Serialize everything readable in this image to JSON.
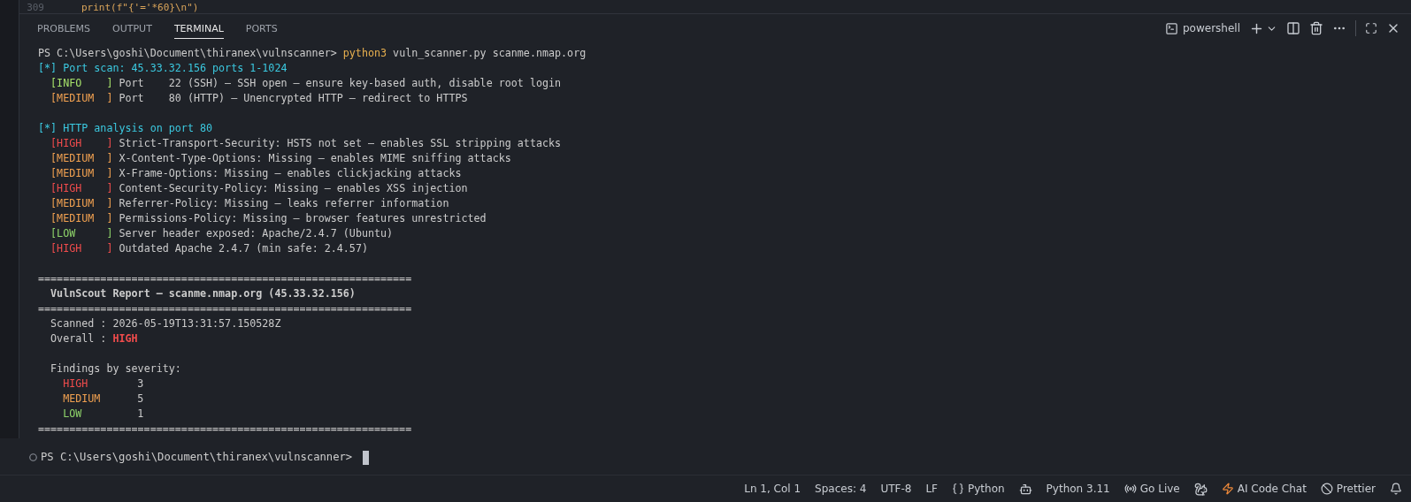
{
  "editor": {
    "line_number": "309",
    "code": "print(f\"{'='*60}\\n\")"
  },
  "panel_tabs": [
    {
      "label": "PROBLEMS",
      "selected": false
    },
    {
      "label": "OUTPUT",
      "selected": false
    },
    {
      "label": "TERMINAL",
      "selected": true
    },
    {
      "label": "PORTS",
      "selected": false
    }
  ],
  "terminal_toolbar": {
    "shell": "powershell"
  },
  "terminal": {
    "lines": [
      {
        "kind": "command",
        "prompt": "PS C:\\Users\\goshi\\Document\\thiranex\\vulnscanner>",
        "program": "python3",
        "args": "vuln_scanner.py scanme.nmap.org"
      },
      {
        "kind": "section",
        "text": "[*] Port scan: 45.33.32.156 ports 1-1024"
      },
      {
        "kind": "finding",
        "tag": "[INFO    ]",
        "color": "#a6e06a",
        "text": "Port    22 (SSH) — SSH open — ensure key-based auth, disable root login"
      },
      {
        "kind": "finding",
        "tag": "[MEDIUM  ]",
        "color": "#f0a050",
        "text": "Port    80 (HTTP) — Unencrypted HTTP — redirect to HTTPS"
      },
      {
        "kind": "blank"
      },
      {
        "kind": "section",
        "text": "[*] HTTP analysis on port 80"
      },
      {
        "kind": "finding",
        "tag": "[HIGH    ]",
        "color": "#f14c4c",
        "text": "Strict-Transport-Security: HSTS not set — enables SSL stripping attacks"
      },
      {
        "kind": "finding",
        "tag": "[MEDIUM  ]",
        "color": "#f0a050",
        "text": "X-Content-Type-Options: Missing — enables MIME sniffing attacks"
      },
      {
        "kind": "finding",
        "tag": "[MEDIUM  ]",
        "color": "#f0a050",
        "text": "X-Frame-Options: Missing — enables clickjacking attacks"
      },
      {
        "kind": "finding",
        "tag": "[HIGH    ]",
        "color": "#f14c4c",
        "text": "Content-Security-Policy: Missing — enables XSS injection"
      },
      {
        "kind": "finding",
        "tag": "[MEDIUM  ]",
        "color": "#f0a050",
        "text": "Referrer-Policy: Missing — leaks referrer information"
      },
      {
        "kind": "finding",
        "tag": "[MEDIUM  ]",
        "color": "#f0a050",
        "text": "Permissions-Policy: Missing — browser features unrestricted"
      },
      {
        "kind": "finding",
        "tag": "[LOW     ]",
        "color": "#8fd46a",
        "text": "Server header exposed: Apache/2.4.7 (Ubuntu)"
      },
      {
        "kind": "finding",
        "tag": "[HIGH    ]",
        "color": "#f14c4c",
        "text": "Outdated Apache 2.4.7 (min safe: 2.4.57)"
      },
      {
        "kind": "blank"
      },
      {
        "kind": "rule",
        "text": "============================================================"
      },
      {
        "kind": "title",
        "text": "VulnScout Report — scanme.nmap.org (45.33.32.156)"
      },
      {
        "kind": "rule",
        "text": "============================================================"
      },
      {
        "kind": "field",
        "text": "Scanned : 2026-05-19T13:31:57.150528Z"
      },
      {
        "kind": "field",
        "text": "Overall : ",
        "value": "HIGH",
        "color": "#f14c4c"
      },
      {
        "kind": "blank"
      },
      {
        "kind": "field",
        "text": "Findings by severity:"
      },
      {
        "kind": "count",
        "tag": "HIGH",
        "color": "#f14c4c",
        "text": "3"
      },
      {
        "kind": "count",
        "tag": "MEDIUM",
        "color": "#f0a050",
        "text": "5"
      },
      {
        "kind": "count",
        "tag": "LOW",
        "color": "#8fd46a",
        "text": "1"
      },
      {
        "kind": "rule",
        "text": "============================================================"
      }
    ],
    "prompt": "PS C:\\Users\\goshi\\Document\\thiranex\\vulnscanner>"
  },
  "status_bar": {
    "position": "Ln 1, Col 1",
    "spaces": "Spaces: 4",
    "encoding": "UTF-8",
    "eol": "LF",
    "language": "Python",
    "interpreter": "Python 3.11",
    "go_live": "Go Live",
    "ai_chat": "AI Code Chat",
    "prettier": "Prettier"
  }
}
